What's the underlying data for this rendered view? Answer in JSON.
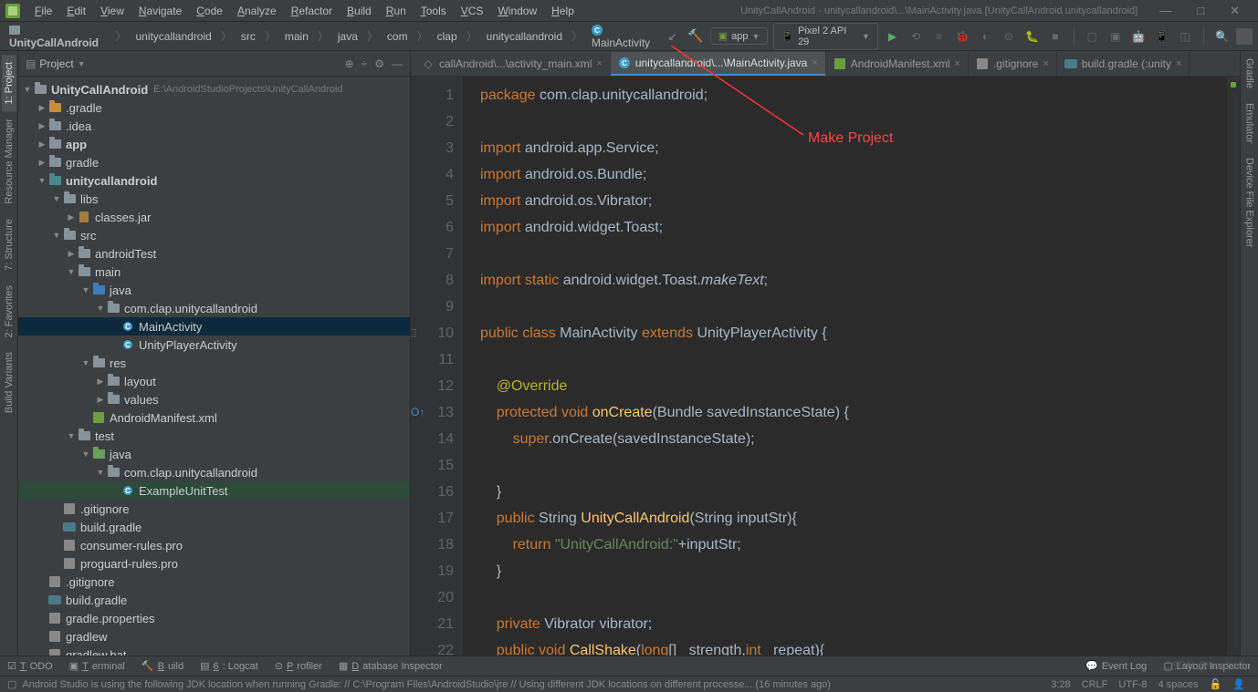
{
  "window": {
    "title": "UnityCallAndroid - unitycallandroid\\...\\MainActivity.java [UnityCallAndroid.unitycallandroid]"
  },
  "menu": [
    "File",
    "Edit",
    "View",
    "Navigate",
    "Code",
    "Analyze",
    "Refactor",
    "Build",
    "Run",
    "Tools",
    "VCS",
    "Window",
    "Help"
  ],
  "breadcrumbs": [
    "UnityCallAndroid",
    "unitycallandroid",
    "src",
    "main",
    "java",
    "com",
    "clap",
    "unitycallandroid",
    "MainActivity"
  ],
  "runconfig": {
    "app": "app",
    "device": "Pixel 2 API 29"
  },
  "annotation": "Make Project",
  "sidebar": {
    "title": "Project",
    "root": {
      "name": "UnityCallAndroid",
      "path": "E:\\AndroidStudioProjects\\UnityCallAndroid"
    },
    "items": [
      {
        "d": 1,
        "t": "folder-orange",
        "e": "r",
        "l": ".gradle"
      },
      {
        "d": 1,
        "t": "folder",
        "e": "r",
        "l": ".idea"
      },
      {
        "d": 1,
        "t": "folder",
        "e": "r",
        "l": "app",
        "bold": true
      },
      {
        "d": 1,
        "t": "folder",
        "e": "r",
        "l": "gradle"
      },
      {
        "d": 1,
        "t": "folder-teal",
        "e": "d",
        "l": "unitycallandroid",
        "bold": true
      },
      {
        "d": 2,
        "t": "folder",
        "e": "d",
        "l": "libs"
      },
      {
        "d": 3,
        "t": "jar",
        "e": "r",
        "l": "classes.jar"
      },
      {
        "d": 2,
        "t": "folder",
        "e": "d",
        "l": "src"
      },
      {
        "d": 3,
        "t": "folder",
        "e": "r",
        "l": "androidTest"
      },
      {
        "d": 3,
        "t": "folder",
        "e": "d",
        "l": "main"
      },
      {
        "d": 4,
        "t": "folder-blue",
        "e": "d",
        "l": "java"
      },
      {
        "d": 5,
        "t": "folder",
        "e": "d",
        "l": "com.clap.unitycallandroid"
      },
      {
        "d": 6,
        "t": "c",
        "e": "",
        "l": "MainActivity",
        "sel": true
      },
      {
        "d": 6,
        "t": "c",
        "e": "",
        "l": "UnityPlayerActivity"
      },
      {
        "d": 4,
        "t": "folder",
        "e": "d",
        "l": "res"
      },
      {
        "d": 5,
        "t": "folder",
        "e": "r",
        "l": "layout"
      },
      {
        "d": 5,
        "t": "folder",
        "e": "r",
        "l": "values"
      },
      {
        "d": 4,
        "t": "manifest",
        "e": "",
        "l": "AndroidManifest.xml"
      },
      {
        "d": 3,
        "t": "folder",
        "e": "d",
        "l": "test"
      },
      {
        "d": 4,
        "t": "folder-green",
        "e": "d",
        "l": "java"
      },
      {
        "d": 5,
        "t": "folder",
        "e": "d",
        "l": "com.clap.unitycallandroid"
      },
      {
        "d": 6,
        "t": "c",
        "e": "",
        "l": "ExampleUnitTest",
        "sel2": true
      },
      {
        "d": 2,
        "t": "gfile",
        "e": "",
        "l": ".gitignore"
      },
      {
        "d": 2,
        "t": "gradle",
        "e": "",
        "l": "build.gradle"
      },
      {
        "d": 2,
        "t": "gfile",
        "e": "",
        "l": "consumer-rules.pro"
      },
      {
        "d": 2,
        "t": "gfile",
        "e": "",
        "l": "proguard-rules.pro"
      },
      {
        "d": 1,
        "t": "gfile",
        "e": "",
        "l": ".gitignore"
      },
      {
        "d": 1,
        "t": "gradle",
        "e": "",
        "l": "build.gradle"
      },
      {
        "d": 1,
        "t": "gfile",
        "e": "",
        "l": "gradle.properties"
      },
      {
        "d": 1,
        "t": "gfile",
        "e": "",
        "l": "gradlew"
      },
      {
        "d": 1,
        "t": "gfile",
        "e": "",
        "l": "gradlew.bat"
      }
    ]
  },
  "lefttabs": [
    "1: Project",
    "Resource Manager",
    "7: Structure",
    "2: Favorites",
    "Build Variants"
  ],
  "righttabs": [
    "Gradle",
    "Emulator",
    "Device File Explorer"
  ],
  "tabs": [
    {
      "l": "callAndroid\\...\\activity_main.xml",
      "a": false,
      "ic": "xml"
    },
    {
      "l": "unitycallandroid\\...\\MainActivity.java",
      "a": true,
      "ic": "c"
    },
    {
      "l": "AndroidManifest.xml",
      "a": false,
      "ic": "manifest"
    },
    {
      "l": ".gitignore",
      "a": false,
      "ic": "g"
    },
    {
      "l": "build.gradle (:unity",
      "a": false,
      "ic": "gradle"
    }
  ],
  "code": {
    "lines": [
      [
        [
          "kw",
          "package "
        ],
        [
          "",
          "com.clap.unitycallandroid;"
        ]
      ],
      [],
      [
        [
          "kw",
          "import "
        ],
        [
          "",
          "android.app.Service;"
        ]
      ],
      [
        [
          "kw",
          "import "
        ],
        [
          "",
          "android.os.Bundle;"
        ]
      ],
      [
        [
          "kw",
          "import "
        ],
        [
          "",
          "android.os.Vibrator;"
        ]
      ],
      [
        [
          "kw",
          "import "
        ],
        [
          "",
          "android.widget.Toast;"
        ]
      ],
      [],
      [
        [
          "kw",
          "import static "
        ],
        [
          "",
          "android.widget.Toast."
        ],
        [
          "it",
          "makeText"
        ],
        [
          "",
          ";"
        ]
      ],
      [],
      [
        [
          "kw",
          "public class "
        ],
        [
          "cls",
          "MainActivity "
        ],
        [
          "kw",
          "extends "
        ],
        [
          "cls",
          "UnityPlayerActivity {"
        ]
      ],
      [],
      [
        [
          "",
          "    "
        ],
        [
          "ann",
          "@Override"
        ]
      ],
      [
        [
          "",
          "    "
        ],
        [
          "kw",
          "protected void "
        ],
        [
          "fn",
          "onCreate"
        ],
        [
          "",
          "(Bundle savedInstanceState) {"
        ]
      ],
      [
        [
          "",
          "        "
        ],
        [
          "kw",
          "super"
        ],
        [
          "",
          ".onCreate(savedInstanceState);"
        ]
      ],
      [],
      [
        [
          "",
          "    }"
        ]
      ],
      [
        [
          "",
          "    "
        ],
        [
          "kw",
          "public "
        ],
        [
          "cls",
          "String "
        ],
        [
          "fn",
          "UnityCallAndroid"
        ],
        [
          "",
          "(String inputStr){"
        ]
      ],
      [
        [
          "",
          "        "
        ],
        [
          "kw",
          "return "
        ],
        [
          "str",
          "\"UnityCallAndroid:\""
        ],
        [
          "",
          "+inputStr;"
        ]
      ],
      [
        [
          "",
          "    }"
        ]
      ],
      [],
      [
        [
          "",
          "    "
        ],
        [
          "kw",
          "private "
        ],
        [
          "cls",
          "Vibrator "
        ],
        [
          "",
          "vibrator;"
        ]
      ],
      [
        [
          "",
          "    "
        ],
        [
          "kw",
          "public void "
        ],
        [
          "fn",
          "CallShake"
        ],
        [
          "",
          "("
        ],
        [
          "kw",
          "long"
        ],
        [
          "",
          "[] _strength,"
        ],
        [
          "kw",
          "int "
        ],
        [
          "",
          "_repeat){"
        ]
      ]
    ]
  },
  "bottombar": [
    "TODO",
    "Terminal",
    "Build",
    "6: Logcat",
    "Profiler",
    "Database Inspector"
  ],
  "bottomright": [
    "Event Log",
    "Layout Inspector"
  ],
  "status": {
    "msg": "Android Studio is using the following JDK location when running Gradle: // C:\\Program Files\\AndroidStudio\\jre // Using different JDK locations on different processe... (16 minutes ago)",
    "pos": "3:28",
    "crlf": "CRLF",
    "enc": "UTF-8",
    "spaces": "4 spaces"
  },
  "watermark": "CSDN @lmabo3o"
}
